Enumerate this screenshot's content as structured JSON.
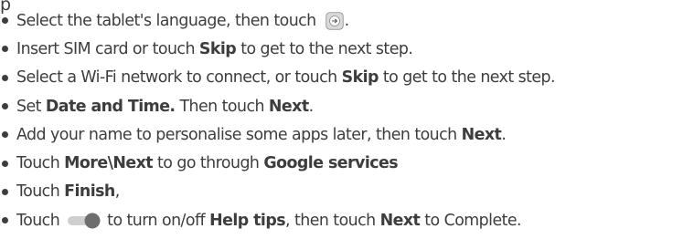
{
  "top_fragment": "p",
  "steps": [
    {
      "segments": [
        {
          "text": "Select the tablet's language, then touch ",
          "bold": false
        },
        {
          "icon": "next-arrow-icon"
        },
        {
          "text": ".",
          "bold": false
        }
      ]
    },
    {
      "segments": [
        {
          "text": "Insert SIM card or touch ",
          "bold": false
        },
        {
          "text": "Skip",
          "bold": true
        },
        {
          "text": " to get to the next step.",
          "bold": false
        }
      ]
    },
    {
      "segments": [
        {
          "text": "Select a Wi-Fi network to connect, or touch ",
          "bold": false
        },
        {
          "text": "Skip",
          "bold": true
        },
        {
          "text": " to get to the next step.",
          "bold": false
        }
      ]
    },
    {
      "segments": [
        {
          "text": "Set ",
          "bold": false
        },
        {
          "text": "Date and Time.",
          "bold": true
        },
        {
          "text": " Then touch ",
          "bold": false
        },
        {
          "text": "Next",
          "bold": true
        },
        {
          "text": ".",
          "bold": false
        }
      ]
    },
    {
      "segments": [
        {
          "text": "Add your name to personalise some apps later, then touch ",
          "bold": false
        },
        {
          "text": "Next",
          "bold": true
        },
        {
          "text": ".",
          "bold": false
        }
      ]
    },
    {
      "segments": [
        {
          "text": "Touch ",
          "bold": false
        },
        {
          "text": "More\\Next",
          "bold": true
        },
        {
          "text": " to go through ",
          "bold": false
        },
        {
          "text": "Google services",
          "bold": true
        }
      ]
    },
    {
      "segments": [
        {
          "text": "Touch ",
          "bold": false
        },
        {
          "text": "Finish",
          "bold": true
        },
        {
          "text": ",",
          "bold": false
        }
      ]
    },
    {
      "segments": [
        {
          "text": "Touch",
          "bold": false
        },
        {
          "icon": "toggle-icon"
        },
        {
          "text": "to turn on/off ",
          "bold": false
        },
        {
          "text": "Help tips",
          "bold": true
        },
        {
          "text": ", then touch ",
          "bold": false
        },
        {
          "text": "Next",
          "bold": true
        },
        {
          "text": " to Complete.",
          "bold": false
        }
      ]
    }
  ],
  "colors": {
    "text": "#3d3d3d",
    "icon_fill": "#d9d9d9",
    "icon_stroke": "#8a8a8a",
    "toggle_track": "#cfcfcf",
    "toggle_knob": "#6e6e6e"
  }
}
